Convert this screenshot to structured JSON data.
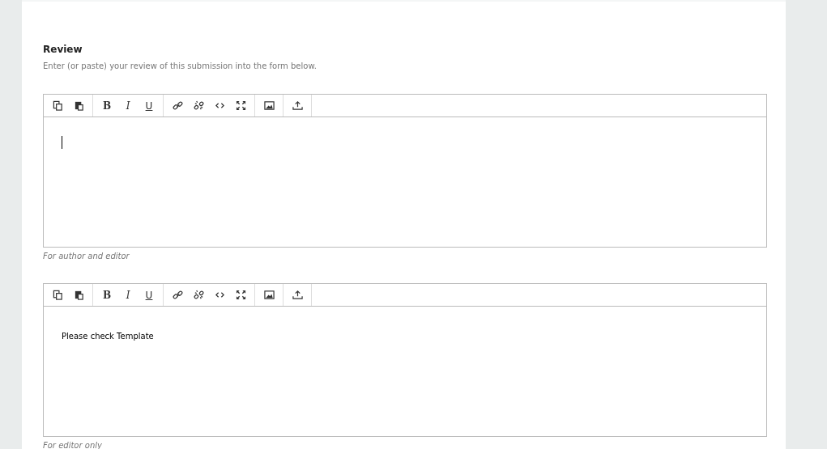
{
  "section": {
    "title": "Review",
    "description": "Enter (or paste) your review of this submission into the form below."
  },
  "editors": [
    {
      "toolbar": [
        [
          {
            "kind": "copy"
          },
          {
            "kind": "paste"
          }
        ],
        [
          {
            "kind": "bold",
            "label": "B"
          },
          {
            "kind": "italic",
            "label": "I"
          },
          {
            "kind": "underline",
            "label": "U"
          }
        ],
        [
          {
            "kind": "link"
          },
          {
            "kind": "unlink"
          },
          {
            "kind": "code"
          },
          {
            "kind": "fullscreen"
          }
        ],
        [
          {
            "kind": "image"
          }
        ],
        [
          {
            "kind": "upload"
          }
        ]
      ],
      "cursor": true,
      "caption": "For author and editor"
    },
    {
      "toolbar": [
        [
          {
            "kind": "copy"
          },
          {
            "kind": "paste"
          }
        ],
        [
          {
            "kind": "bold",
            "label": "B"
          },
          {
            "kind": "italic",
            "label": "I"
          },
          {
            "kind": "underline",
            "label": "U"
          }
        ],
        [
          {
            "kind": "link"
          },
          {
            "kind": "unlink"
          },
          {
            "kind": "code"
          },
          {
            "kind": "fullscreen"
          }
        ],
        [
          {
            "kind": "image"
          }
        ],
        [
          {
            "kind": "upload"
          }
        ]
      ],
      "text": "Please check Template",
      "cursor": false,
      "caption": "For editor only"
    }
  ]
}
